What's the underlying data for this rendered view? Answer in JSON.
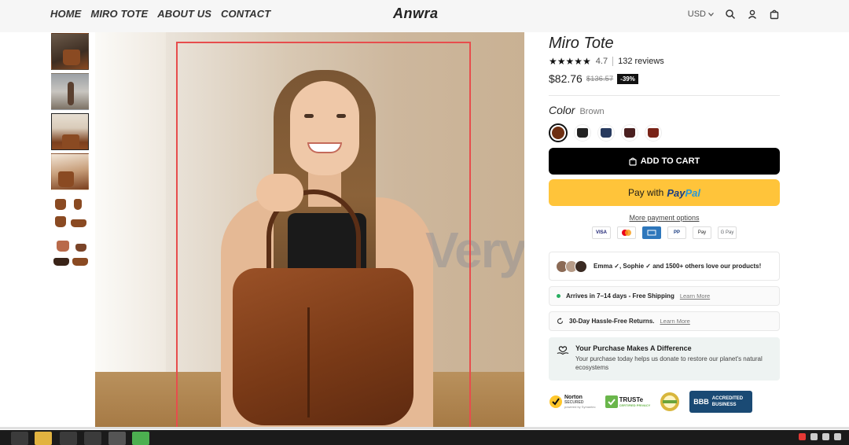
{
  "nav": {
    "items": [
      "HOME",
      "MIRO TOTE",
      "ABOUT US",
      "CONTACT"
    ],
    "brand": "Anwra",
    "currency": "USD"
  },
  "gallery": {
    "watermark": "VeryFb",
    "thumb_count": 6,
    "active_thumb": 3
  },
  "product": {
    "title": "Miro Tote",
    "stars": "★★★★★",
    "rating": "4.7",
    "reviews": "132 reviews",
    "price": "$82.76",
    "compare_price": "$136.57",
    "discount": "-39%",
    "color_label": "Color",
    "color_value": "Brown",
    "swatches": [
      "Brown",
      "Black",
      "Navy",
      "Burgundy",
      "Red-Brown"
    ],
    "add_to_cart": "ADD TO CART",
    "paypal_prefix": "Pay with",
    "paypal_pay": "Pay",
    "paypal_pal": "Pal",
    "more_payment": "More payment options",
    "pay_methods": [
      "VISA",
      "MC",
      "AMEX",
      "PP",
      "Pay",
      "G Pay"
    ]
  },
  "trust": {
    "social_proof": "Emma ✓, Sophie ✓ and 1500+ others love our products!",
    "shipping_label": "Arrives in 7–14 days - Free Shipping",
    "shipping_link": "Learn More",
    "returns_label": "30-Day Hassle-Free Returns.",
    "returns_link": "Learn More",
    "impact_title": "Your Purchase Makes A Difference",
    "impact_text": "Your purchase today helps us donate to restore our planet's natural ecosystems",
    "badges": {
      "norton": "Norton",
      "norton_sub": "SECURED",
      "norton_powered": "powered by Symantec",
      "truste": "TRUSTe",
      "truste_sub": "CERTIFIED PRIVACY",
      "bbb": "BBB",
      "bbb_text": "ACCREDITED BUSINESS"
    }
  },
  "colors": {
    "accent": "#ffc43a",
    "cart": "#000000",
    "selection": "#e74d4d"
  }
}
